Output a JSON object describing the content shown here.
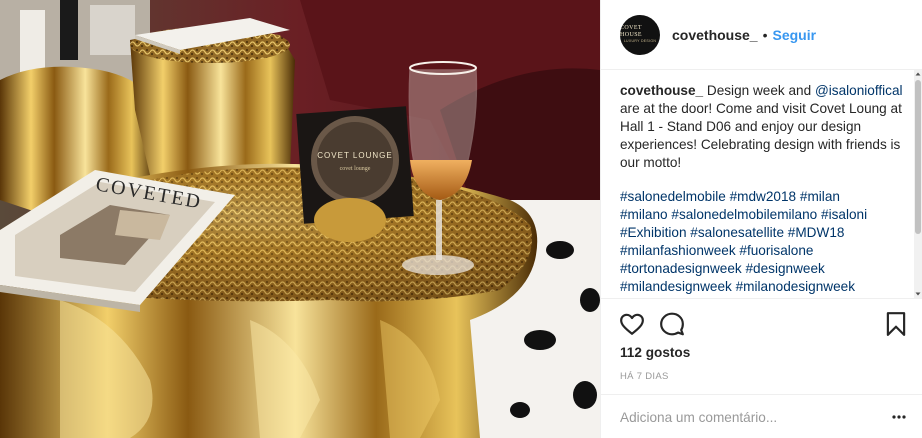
{
  "post": {
    "username": "covethouse_",
    "separator": "•",
    "follow_label": "Seguir",
    "avatar_line1": "COVET HOUSE",
    "avatar_line2": "LUXURY DESIGN"
  },
  "caption": {
    "user": "covethouse_",
    "text_1": " Design week and ",
    "mention": "@isalonioffical",
    "text_2": " are at the door! Come and visit Covet Loung at Hall 1 - Stand D06 and enjoy our design experiences! Celebrating design with friends is our motto!"
  },
  "hashtags": [
    "#salonedelmobile",
    "#mdw2018",
    "#milan",
    "#milano",
    "#salonedelmobilemilano",
    "#isaloni",
    "#Exhibition",
    "#salonesatellite",
    "#MDW18",
    "#milanfashionweek",
    "#fuorisalone",
    "#tortonadesignweek",
    "#designweek",
    "#milandesignweek",
    "#milanodesignweek"
  ],
  "actions": {
    "like_icon": "heart-icon",
    "comment_icon": "comment-icon",
    "save_icon": "bookmark-icon"
  },
  "likes_text": "112 gostos",
  "time_text": "HÁ 7 DIAS",
  "comment_input": {
    "placeholder": "Adiciona um comentário...",
    "value": ""
  },
  "more_icon": "ellipsis-icon",
  "photo": {
    "magazine_title": "COVETED",
    "sign_line1": "COVET LOUNGE",
    "sign_line2": "covet lounge"
  },
  "colors": {
    "link": "#3897f0",
    "hashtag": "#003569",
    "text": "#262626",
    "muted": "#999999",
    "border": "#efefef"
  }
}
